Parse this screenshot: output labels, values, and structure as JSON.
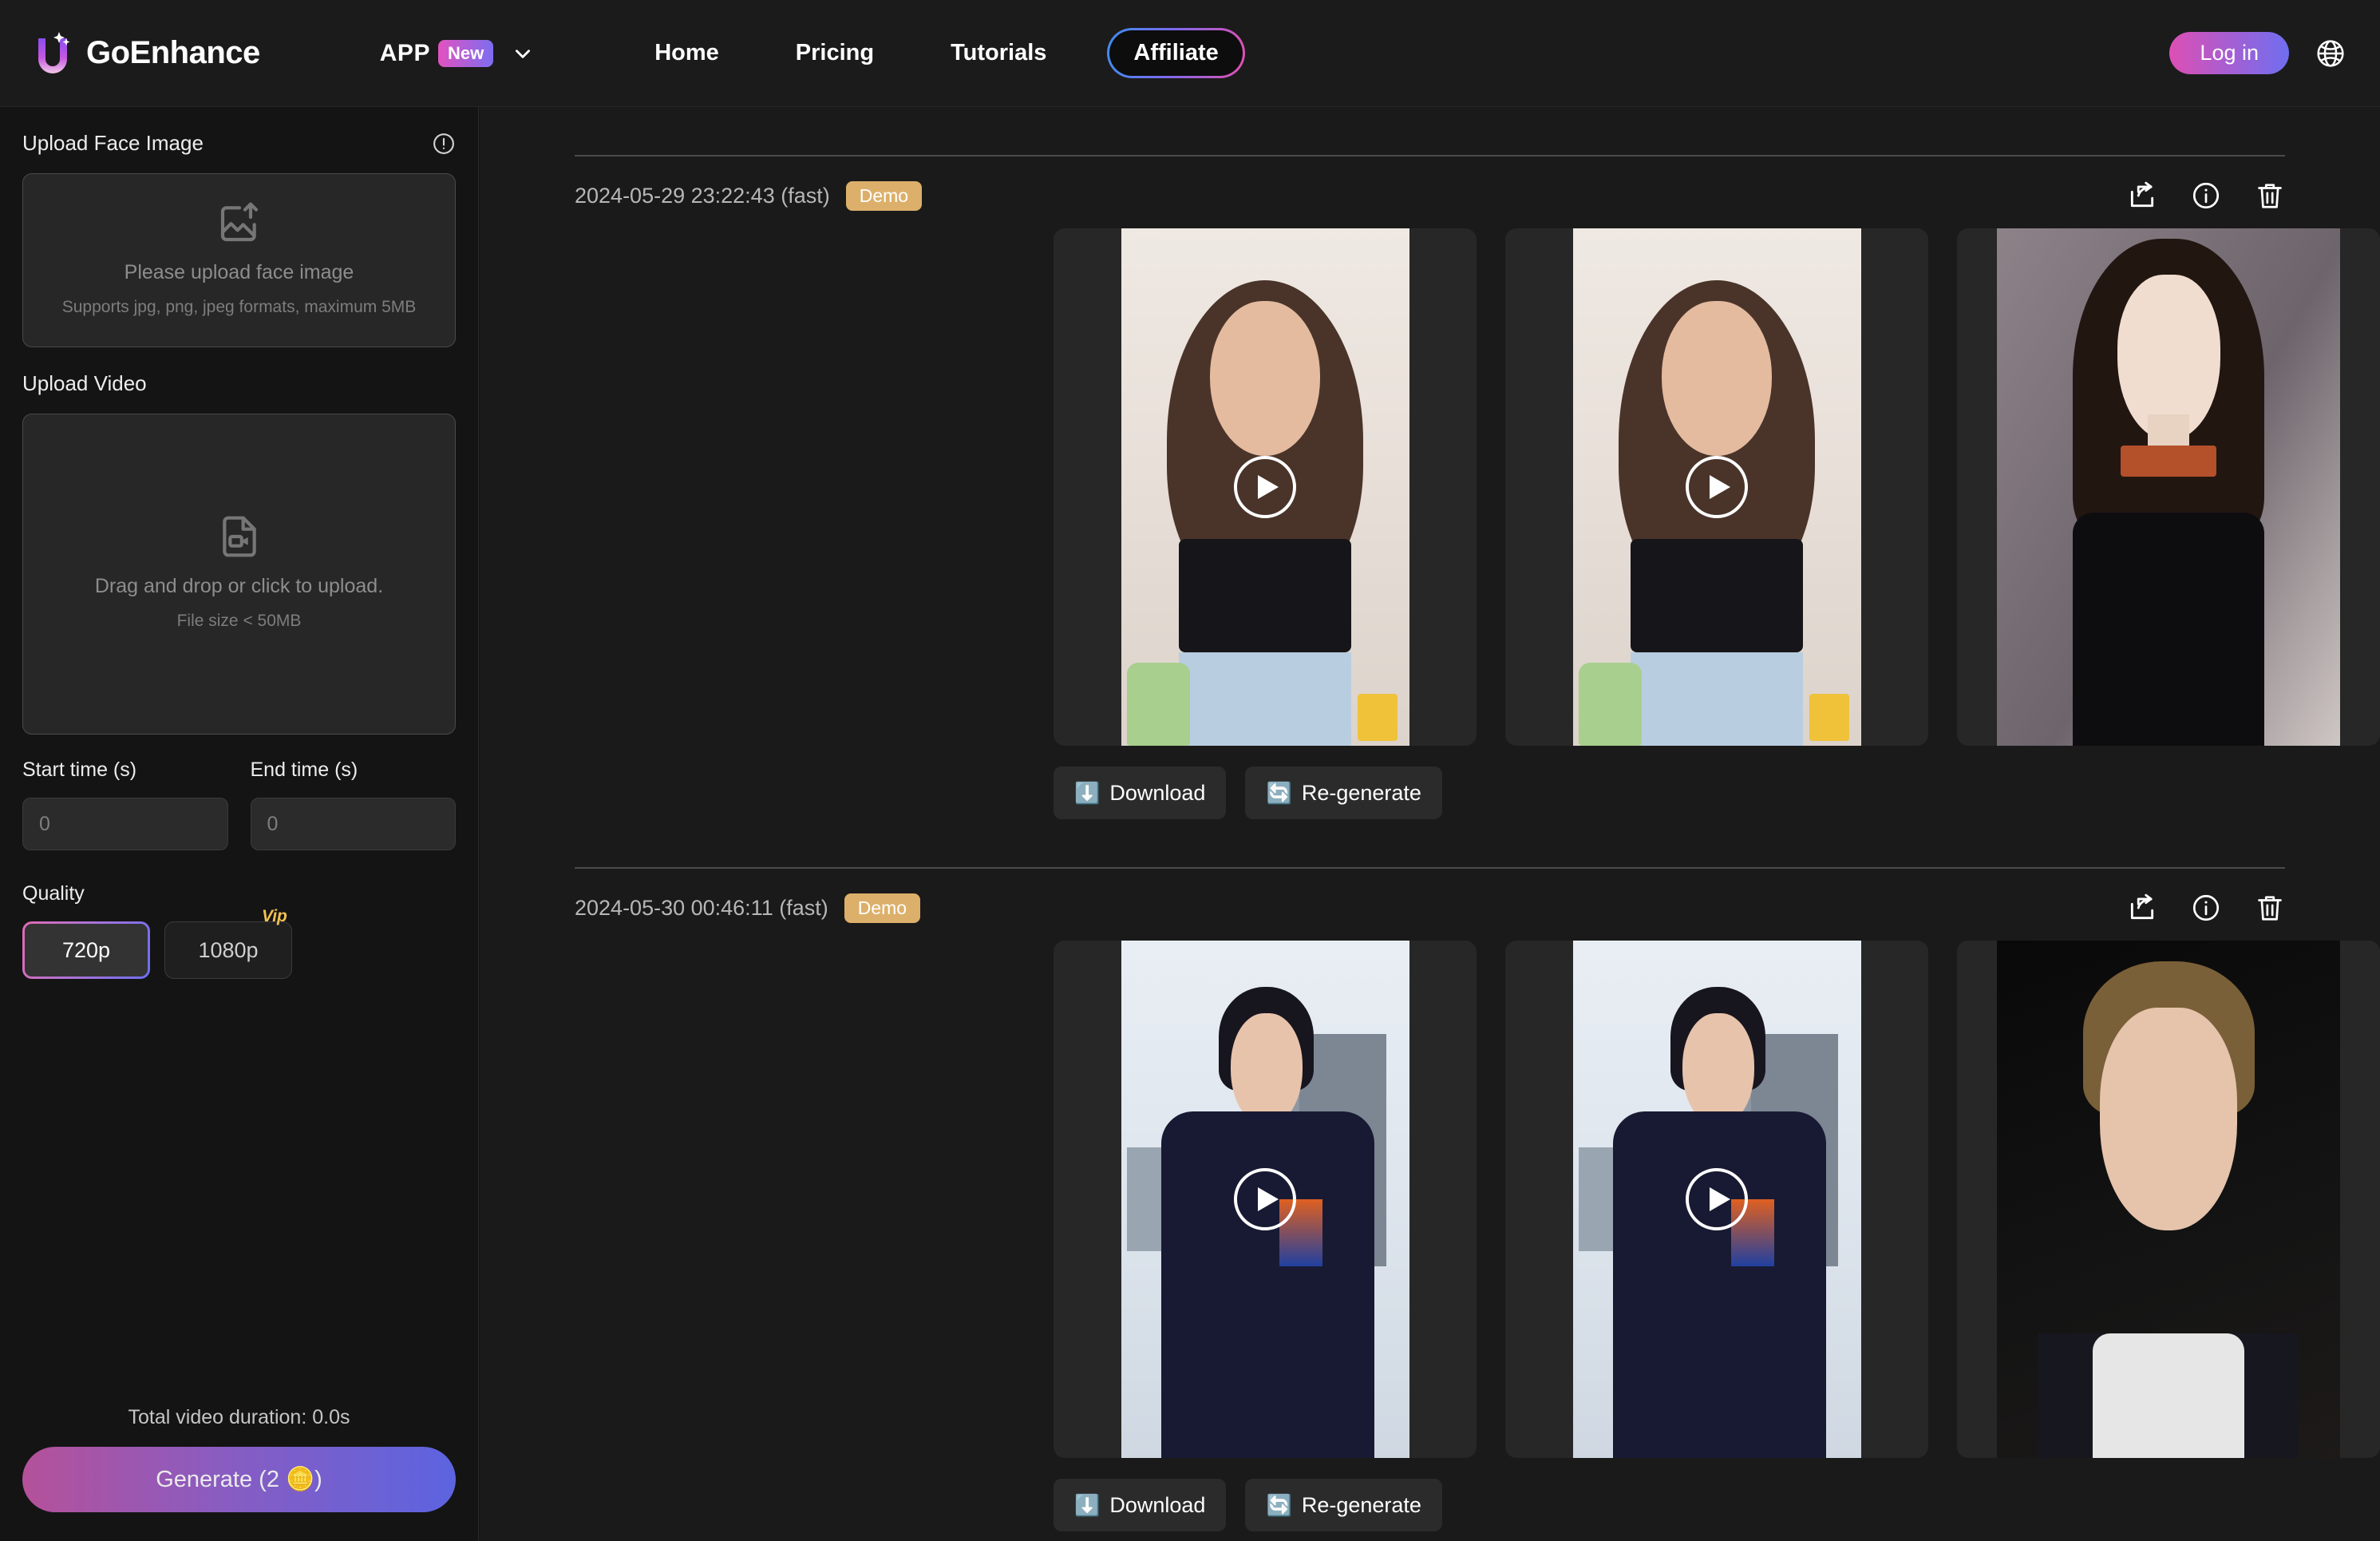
{
  "header": {
    "brand_name": "GoEnhance",
    "logo_icon": "u-sparkle-logo-icon",
    "app_menu": {
      "label": "APP",
      "badge": "New",
      "chevron_icon": "chevron-down-icon"
    },
    "nav": [
      {
        "label": "Home",
        "icon": ""
      },
      {
        "label": "Pricing",
        "icon": ""
      },
      {
        "label": "Tutorials",
        "icon": ""
      }
    ],
    "affiliate": {
      "label": "Affiliate"
    },
    "login": {
      "label": "Log in"
    },
    "language_icon": "globe-icon",
    "accents": {
      "brand_pink": "#dd4fb4",
      "brand_purple": "#7d6df0",
      "brand_blue": "#3d8ef0"
    }
  },
  "sidebar": {
    "face_upload": {
      "label": "Upload Face Image",
      "info_icon": "info-alert-icon",
      "icon": "image-upload-icon",
      "title": "Please upload face image",
      "subtitle": "Supports jpg, png, jpeg formats, maximum 5MB"
    },
    "video_upload": {
      "label": "Upload Video",
      "icon": "video-file-icon",
      "title": "Drag and drop or click to upload.",
      "subtitle": "File size < 50MB"
    },
    "start_time": {
      "label": "Start time (s)",
      "value": "",
      "placeholder": "0"
    },
    "end_time": {
      "label": "End time (s)",
      "value": "",
      "placeholder": "0"
    },
    "quality": {
      "label": "Quality",
      "options": [
        {
          "label": "720p",
          "selected": true,
          "vip": false
        },
        {
          "label": "1080p",
          "selected": false,
          "vip": true
        }
      ],
      "vip_badge": "Vip"
    },
    "duration_text": "Total video duration: 0.0s",
    "generate": {
      "label": "Generate (2 🪙)",
      "coin_icon": "coin-stack-icon"
    }
  },
  "results": [
    {
      "timestamp": "2024-05-29 23:22:43 (fast)",
      "badge": "Demo",
      "actions": [
        {
          "icon": "share-icon"
        },
        {
          "icon": "info-icon"
        },
        {
          "icon": "trash-icon"
        }
      ],
      "cards": [
        {
          "kind": "video",
          "art": "f1",
          "play_icon": "play-icon",
          "label": "source-video"
        },
        {
          "kind": "video",
          "art": "f1",
          "play_icon": "play-icon",
          "label": "result-video"
        },
        {
          "kind": "image",
          "art": "f3",
          "play_icon": "",
          "label": "face-reference"
        }
      ],
      "buttons": [
        {
          "label": "Download",
          "emoji": "⬇️",
          "icon": "download-icon"
        },
        {
          "label": "Re-generate",
          "emoji": "🔄",
          "icon": "regenerate-icon"
        }
      ]
    },
    {
      "timestamp": "2024-05-30 00:46:11 (fast)",
      "badge": "Demo",
      "actions": [
        {
          "icon": "share-icon"
        },
        {
          "icon": "info-icon"
        },
        {
          "icon": "trash-icon"
        }
      ],
      "cards": [
        {
          "kind": "video",
          "art": "f2",
          "play_icon": "play-icon",
          "label": "source-video"
        },
        {
          "kind": "video",
          "art": "f2",
          "play_icon": "play-icon",
          "label": "result-video"
        },
        {
          "kind": "image",
          "art": "f4",
          "play_icon": "",
          "label": "face-reference"
        }
      ],
      "buttons": [
        {
          "label": "Download",
          "emoji": "⬇️",
          "icon": "download-icon"
        },
        {
          "label": "Re-generate",
          "emoji": "🔄",
          "icon": "regenerate-icon"
        }
      ]
    }
  ]
}
